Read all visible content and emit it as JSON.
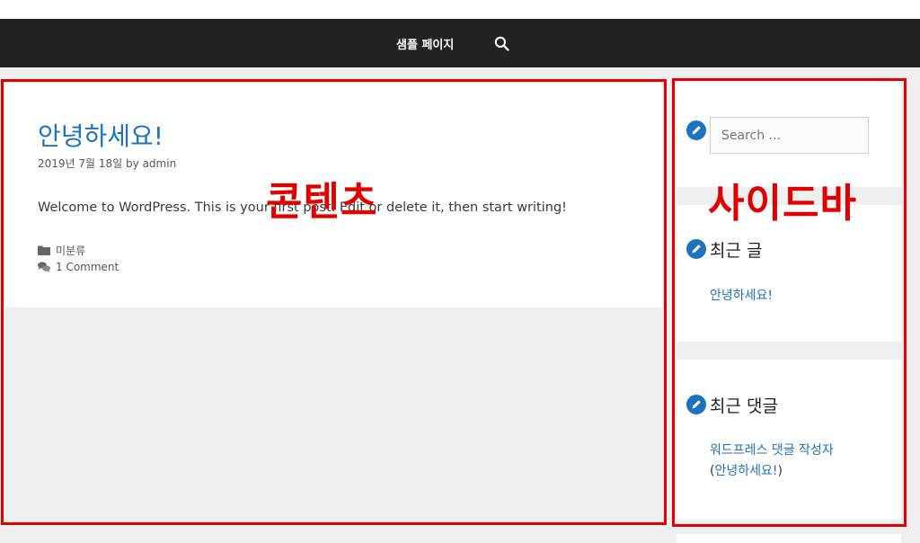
{
  "nav": {
    "item": "샘플 페이지",
    "search_icon": "search-icon"
  },
  "post": {
    "title": "안녕하세요!",
    "date": "2019년 7월 18일",
    "by": "by",
    "author": "admin",
    "body": "Welcome to WordPress. This is your first post. Edit or delete it, then start writing!",
    "category": "미분류",
    "comments": "1 Comment"
  },
  "sidebar": {
    "search_placeholder": "Search ...",
    "recent_posts_title": "최근 글",
    "recent_post_link": "안녕하세요!",
    "recent_comments_title": "최근 댓글",
    "comment_author": "워드프레스 댓글 작성자",
    "comment_post_open": "(",
    "comment_post": "안녕하세요!",
    "comment_post_close": ")"
  },
  "annotations": {
    "content_label": "콘텐츠",
    "sidebar_label": "사이드바",
    "color": "#e00000"
  },
  "colors": {
    "nav_bg": "#222222",
    "link": "#1e73be",
    "page_bg": "#efefef"
  }
}
